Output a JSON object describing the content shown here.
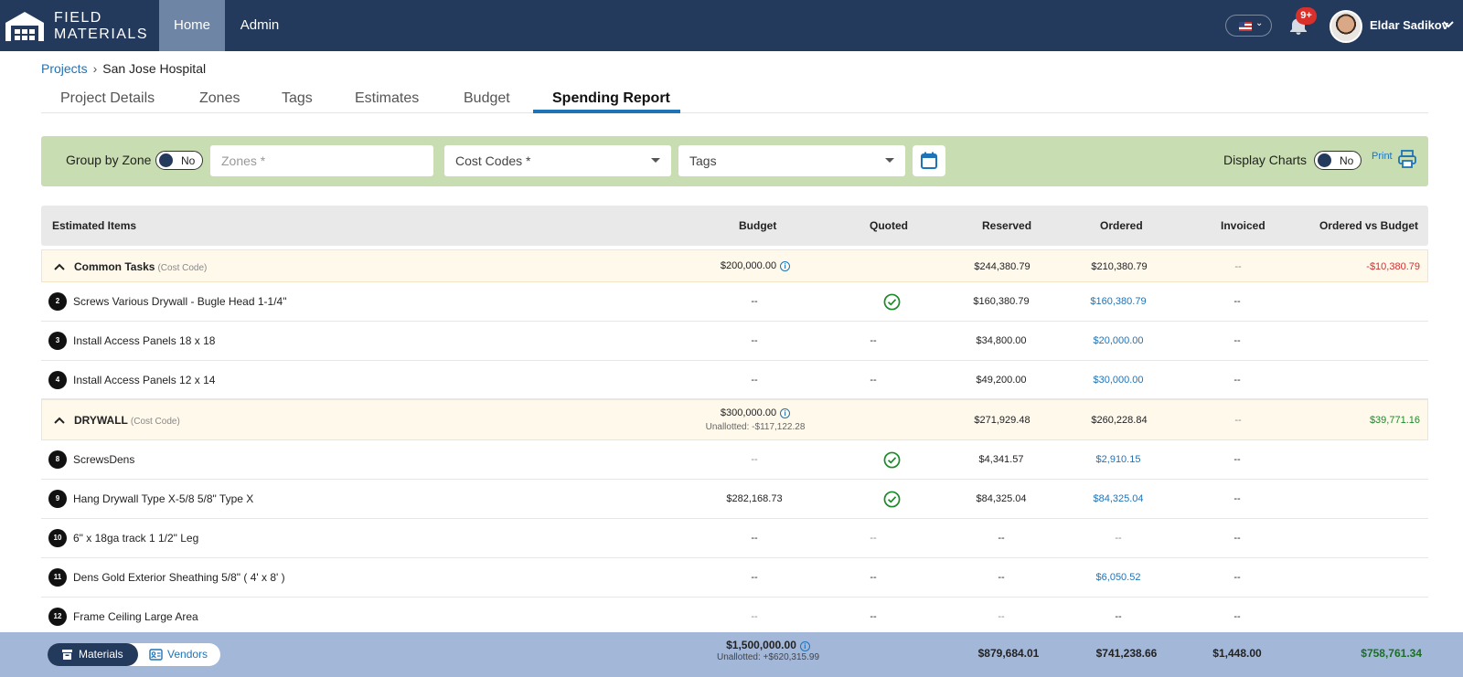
{
  "app": {
    "logo_line1": "FIELD",
    "logo_line2": "MATERIALS"
  },
  "nav": {
    "home": "Home",
    "admin": "Admin"
  },
  "notifications": {
    "badge": "9+"
  },
  "user": {
    "name": "Eldar Sadikov"
  },
  "breadcrumb": {
    "root": "Projects",
    "separator": "›",
    "current": "San Jose Hospital"
  },
  "tabs": [
    "Project Details",
    "Zones",
    "Tags",
    "Estimates",
    "Budget",
    "Spending Report"
  ],
  "filters": {
    "group_by_zone_label": "Group by Zone",
    "group_by_zone_value": "No",
    "zones_placeholder": "Zones *",
    "cost_codes_label": "Cost Codes *",
    "tags_label": "Tags",
    "display_charts_label": "Display Charts",
    "display_charts_value": "No",
    "print_label": "Print"
  },
  "table": {
    "headers": {
      "items": "Estimated Items",
      "budget": "Budget",
      "quoted": "Quoted",
      "reserved": "Reserved",
      "ordered": "Ordered",
      "invoiced": "Invoiced",
      "ovb": "Ordered vs Budget"
    },
    "cost_code_tag": "(Cost Code)",
    "groups": [
      {
        "name": "Common Tasks",
        "budget": "$200,000.00",
        "unallotted": "",
        "reserved": "$244,380.79",
        "ordered": "$210,380.79",
        "invoiced": "--",
        "ovb": "-$10,380.79"
      },
      {
        "name": "DRYWALL",
        "budget": "$300,000.00",
        "unallotted": "Unallotted: -$117,122.28",
        "reserved": "$271,929.48",
        "ordered": "$260,228.84",
        "invoiced": "--",
        "ovb": "$39,771.16"
      }
    ],
    "items": [
      {
        "num": "2",
        "name": "Screws Various Drywall - Bugle Head 1-1/4\"",
        "budget": "--",
        "quoted": "",
        "reserved": "$160,380.79",
        "ordered": "$160,380.79",
        "invoiced": "--"
      },
      {
        "num": "3",
        "name": "Install Access Panels 18 x 18",
        "budget": "--",
        "quoted": "--",
        "reserved": "$34,800.00",
        "ordered": "$20,000.00",
        "invoiced": "--"
      },
      {
        "num": "4",
        "name": "Install Access Panels 12 x 14",
        "budget": "--",
        "quoted": "--",
        "reserved": "$49,200.00",
        "ordered": "$30,000.00",
        "invoiced": "--"
      },
      {
        "num": "8",
        "name": "ScrewsDens",
        "budget": "--",
        "quoted": "",
        "reserved": "$4,341.57",
        "ordered": "$2,910.15",
        "invoiced": "--"
      },
      {
        "num": "9",
        "name": "Hang Drywall Type X-5/8 5/8\" Type X",
        "budget": "$282,168.73",
        "quoted": "",
        "reserved": "$84,325.04",
        "ordered": "$84,325.04",
        "invoiced": "--"
      },
      {
        "num": "10",
        "name": "6\" x 18ga track 1 1/2\" Leg",
        "budget": "--",
        "quoted": "--",
        "reserved": "--",
        "ordered": "--",
        "invoiced": "--"
      },
      {
        "num": "11",
        "name": "Dens Gold Exterior Sheathing 5/8\" ( 4' x 8' )",
        "budget": "--",
        "quoted": "--",
        "reserved": "--",
        "ordered": "$6,050.52",
        "invoiced": "--"
      },
      {
        "num": "12",
        "name": "Frame Ceiling Large Area",
        "budget": "--",
        "quoted": "--",
        "reserved": "--",
        "ordered": "--",
        "invoiced": "--"
      }
    ]
  },
  "footer": {
    "materials": "Materials",
    "vendors": "Vendors",
    "budget": "$1,500,000.00",
    "unallotted": "Unallotted: +$620,315.99",
    "reserved": "$879,684.01",
    "ordered": "$741,238.66",
    "invoiced": "$1,448.00",
    "ovb": "$758,761.34"
  },
  "colors": {
    "nav_bg": "#233a5c",
    "accent": "#1f73b7",
    "filter_bg": "#c9ddb3",
    "footer_bg": "#a3b7d9",
    "negative": "#d32f2f",
    "positive": "#1b8a2a"
  }
}
